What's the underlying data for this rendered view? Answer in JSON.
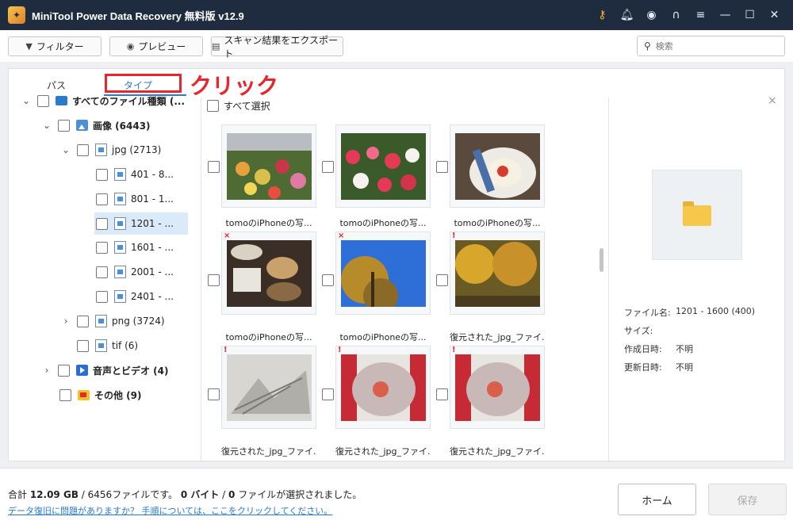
{
  "window": {
    "title": "MiniTool Power Data Recovery 無料版 v12.9",
    "icons": [
      "key-icon",
      "bell-icon",
      "disc-icon",
      "headset-icon",
      "menu-icon",
      "minimize-icon",
      "maximize-icon",
      "close-icon"
    ]
  },
  "toolbar": {
    "filter_label": "フィルター",
    "preview_label": "プレビュー",
    "export_label": "スキャン結果をエクスポート",
    "search_placeholder": "検索"
  },
  "tabs": {
    "path_label": "パス",
    "type_label": "タイプ",
    "active": "type"
  },
  "annotation": {
    "click_label": "クリック",
    "color": "#e8262b"
  },
  "tree": {
    "all": "すべてのファイル種類 (...",
    "images": "画像 (6443)",
    "jpg": "jpg (2713)",
    "jpg_children": [
      "401 - 8...",
      "801 - 1...",
      "1201 - ...",
      "1601 - ...",
      "2001 - ...",
      "2401 - ..."
    ],
    "selected_child_index": 2,
    "png": "png (3724)",
    "tif": "tif (6)",
    "audio_video": "音声とビデオ (4)",
    "other": "その他 (9)"
  },
  "grid": {
    "select_all_label": "すべて選択",
    "items": [
      {
        "label": "tomoのiPhoneの写...",
        "mark": ""
      },
      {
        "label": "tomoのiPhoneの写...",
        "mark": ""
      },
      {
        "label": "tomoのiPhoneの写...",
        "mark": ""
      },
      {
        "label": "tomoのiPhoneの写...",
        "mark": "×"
      },
      {
        "label": "tomoのiPhoneの写...",
        "mark": "×"
      },
      {
        "label": "復元された_jpg_ファイ...",
        "mark": "!"
      },
      {
        "label": "復元された_jpg_ファイ...",
        "mark": "!"
      },
      {
        "label": "復元された_jpg_ファイ...",
        "mark": "!"
      },
      {
        "label": "復元された_jpg_ファイ...",
        "mark": "!"
      }
    ]
  },
  "preview": {
    "filename_key": "ファイル名:",
    "filename_value": "1201 - 1600 (400)",
    "size_key": "サイズ:",
    "size_value": "",
    "created_key": "作成日時:",
    "created_value": "不明",
    "modified_key": "更新日時:",
    "modified_value": "不明"
  },
  "footer": {
    "summary_prefix": "合計 ",
    "total_size": "12.09 GB",
    "summary_sep": " / ",
    "total_files": "6456",
    "summary_mid": "ファイルです。 ",
    "selected_size": "0 バイト",
    "summary_sep2": " / ",
    "selected_files": "0",
    "summary_end": " ファイルが選択されました。",
    "help_link": "データ復旧に問題がありますか？ 手順については、ここをクリックしてください。",
    "home_label": "ホーム",
    "save_label": "保存"
  },
  "colors": {
    "titlebar": "#1f2c3f",
    "accent": "#2a7ad0",
    "annotation_red": "#e8262b"
  }
}
